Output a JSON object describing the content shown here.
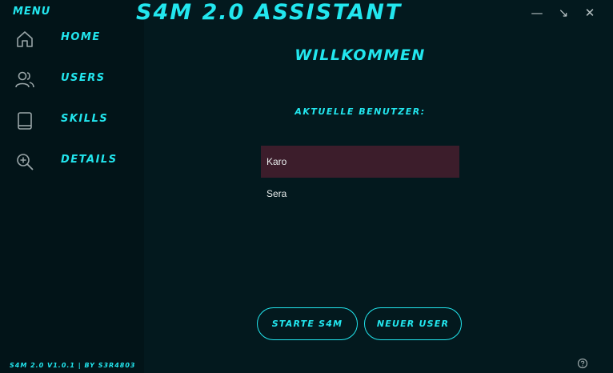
{
  "header": {
    "menu_label": "MENU",
    "app_title": "S4M 2.0 ASSISTANT",
    "minimize_glyph": "—",
    "restore_glyph": "↘",
    "close_glyph": "✕"
  },
  "sidebar": {
    "items": [
      {
        "label": "HOME",
        "icon": "home-icon"
      },
      {
        "label": "USERS",
        "icon": "users-icon"
      },
      {
        "label": "SKILLS",
        "icon": "book-icon"
      },
      {
        "label": "DETAILS",
        "icon": "zoom-in-icon"
      }
    ]
  },
  "main": {
    "welcome": "WILLKOMMEN",
    "current_users_label": "AKTUELLE BENUTZER:",
    "users": [
      "Karo",
      "Sera"
    ],
    "selected_user": "Karo"
  },
  "buttons": {
    "start": "STARTE S4M",
    "new_user": "NEUER USER"
  },
  "footer": {
    "version_text": "S4M 2.0 V1.0.1 | BY S3R4803",
    "help_icon": "help-icon"
  },
  "colors": {
    "accent": "#22e6ee",
    "background": "#03191e",
    "selected_row": "#3c1d2b"
  }
}
